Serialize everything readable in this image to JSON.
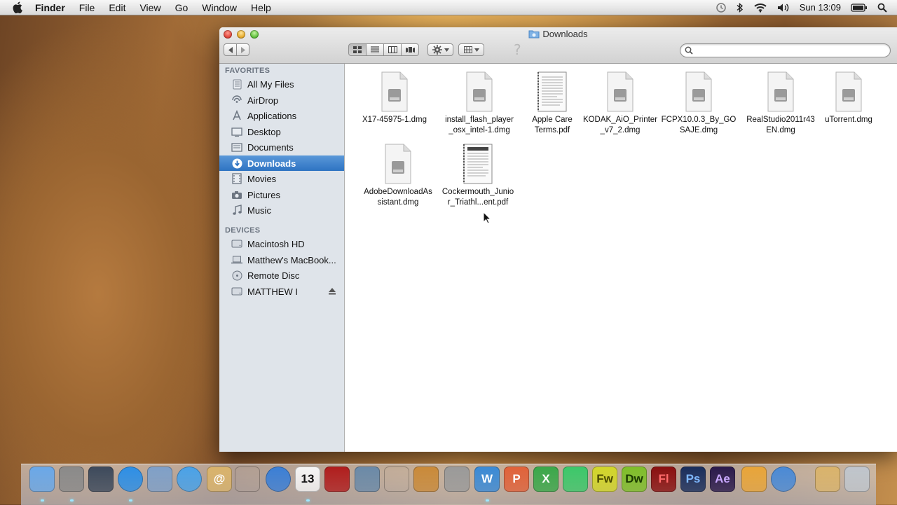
{
  "menubar": {
    "items": [
      "Finder",
      "File",
      "Edit",
      "View",
      "Go",
      "Window",
      "Help"
    ],
    "clock": "Sun 13:09",
    "status_icons": [
      "time-machine-icon",
      "bluetooth-icon",
      "wifi-icon",
      "volume-icon",
      "battery-icon",
      "spotlight-icon"
    ]
  },
  "window": {
    "title": "Downloads",
    "search": {
      "placeholder": "",
      "value": ""
    },
    "help_glyph": "?"
  },
  "sidebar": {
    "favorites_header": "FAVORITES",
    "favorites": [
      {
        "label": "All My Files",
        "icon": "all-files-icon"
      },
      {
        "label": "AirDrop",
        "icon": "airdrop-icon"
      },
      {
        "label": "Applications",
        "icon": "applications-icon"
      },
      {
        "label": "Desktop",
        "icon": "desktop-icon"
      },
      {
        "label": "Documents",
        "icon": "documents-icon"
      },
      {
        "label": "Downloads",
        "icon": "downloads-icon",
        "selected": true
      },
      {
        "label": "Movies",
        "icon": "movies-icon"
      },
      {
        "label": "Pictures",
        "icon": "pictures-icon"
      },
      {
        "label": "Music",
        "icon": "music-icon"
      }
    ],
    "devices_header": "DEVICES",
    "devices": [
      {
        "label": "Macintosh HD",
        "icon": "hard-disk-icon"
      },
      {
        "label": "Matthew's MacBook...",
        "icon": "laptop-icon"
      },
      {
        "label": "Remote Disc",
        "icon": "disc-icon"
      },
      {
        "label": "MATTHEW I",
        "icon": "usb-drive-icon",
        "ejectable": true
      }
    ]
  },
  "files": [
    {
      "name": "X17-45975-1.dmg",
      "kind": "dmg"
    },
    {
      "name": "install_flash_player_osx_intel-1.dmg",
      "kind": "dmg"
    },
    {
      "name": "Apple Care Terms.pdf",
      "kind": "pdf"
    },
    {
      "name": "KODAK_AiO_Printer_v7_2.dmg",
      "kind": "dmg"
    },
    {
      "name": "FCPX10.0.3_By_GOSAJE.dmg",
      "kind": "dmg"
    },
    {
      "name": "RealStudio2011r43EN.dmg",
      "kind": "dmg"
    },
    {
      "name": "uTorrent.dmg",
      "kind": "dmg"
    },
    {
      "name": "AdobeDownloadAssistant.dmg",
      "kind": "dmg"
    },
    {
      "name": "Cockermouth_Junior_Triathl...ent.pdf",
      "kind": "pdf"
    }
  ],
  "file_labels": {
    "f0": [
      "X17-45975-1.dmg"
    ],
    "f1": [
      "install_flash_player",
      "_osx_intel-1.dmg"
    ],
    "f2": [
      "Apple Care",
      "Terms.pdf"
    ],
    "f3": [
      "KODAK_AiO_Printer",
      "_v7_2.dmg"
    ],
    "f4": [
      "FCPX10.0.3_By_GO",
      "SAJE.dmg"
    ],
    "f5": [
      "RealStudio2011r43",
      "EN.dmg"
    ],
    "f6": [
      "uTorrent.dmg"
    ],
    "f7": [
      "AdobeDownloadAs",
      "sistant.dmg"
    ],
    "f8": [
      "Cockermouth_Junio",
      "r_Triathl...ent.pdf"
    ]
  },
  "dock": {
    "items": [
      {
        "name": "finder",
        "label": ""
      },
      {
        "name": "launchpad",
        "label": ""
      },
      {
        "name": "mission-control",
        "label": ""
      },
      {
        "name": "app-store",
        "label": ""
      },
      {
        "name": "preview",
        "label": ""
      },
      {
        "name": "safari",
        "label": ""
      },
      {
        "name": "contacts",
        "label": "@"
      },
      {
        "name": "facetime",
        "label": ""
      },
      {
        "name": "itunes",
        "label": ""
      },
      {
        "name": "calendar",
        "label": "13"
      },
      {
        "name": "photo-booth",
        "label": ""
      },
      {
        "name": "iphoto",
        "label": ""
      },
      {
        "name": "imovie",
        "label": ""
      },
      {
        "name": "garageband",
        "label": ""
      },
      {
        "name": "system-preferences",
        "label": ""
      },
      {
        "name": "word",
        "label": "W"
      },
      {
        "name": "powerpoint",
        "label": "P"
      },
      {
        "name": "excel",
        "label": "X"
      },
      {
        "name": "sketchup",
        "label": ""
      },
      {
        "name": "fireworks",
        "label": "Fw"
      },
      {
        "name": "dreamweaver",
        "label": "Dw"
      },
      {
        "name": "flash",
        "label": "Fl"
      },
      {
        "name": "photoshop",
        "label": "Ps"
      },
      {
        "name": "after-effects",
        "label": "Ae"
      },
      {
        "name": "scratch",
        "label": ""
      },
      {
        "name": "quicktime",
        "label": ""
      },
      {
        "name": "downloads-stack",
        "label": ""
      },
      {
        "name": "trash",
        "label": ""
      }
    ]
  },
  "colors": {
    "selection": "#3a7fcc",
    "sidebar_bg": "#dfe4ea",
    "sidebar_header": "#6b7480"
  }
}
